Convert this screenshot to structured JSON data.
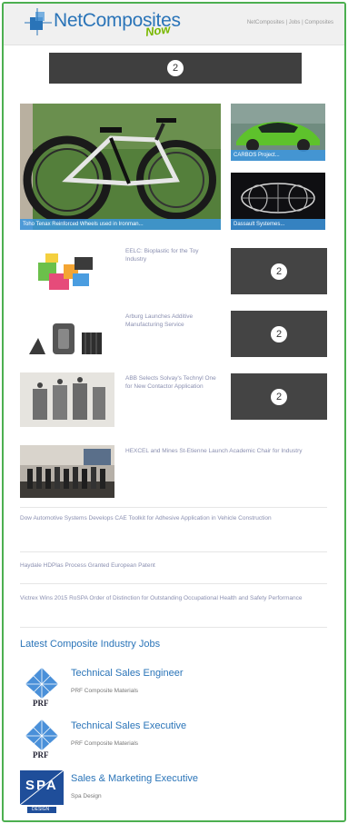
{
  "header": {
    "logo_text": "NetComposites",
    "logo_now": "Now",
    "right_text": "NetComposites | Jobs | Composites"
  },
  "ads": {
    "badge": "2"
  },
  "features": [
    {
      "caption": "Toho Tenax Reinforced Wheels used in Ironman..."
    },
    {
      "caption": "CARBOS Project..."
    },
    {
      "caption": "Dassault Systemes..."
    }
  ],
  "news": [
    {
      "title": "EELC: Bioplastic for the Toy Industry"
    },
    {
      "title": "Arburg Launches Additive Manufacturing Service"
    },
    {
      "title": "ABB Selects Solvay's Technyl One for New Contactor Application"
    },
    {
      "title": "HEXCEL and Mines St-Etienne Launch Academic Chair for Industry"
    }
  ],
  "links": [
    {
      "text": "Dow Automotive Systems Develops CAE Toolkit for Adhesive Application in Vehicle Construction"
    },
    {
      "text": "Haydale HDPlas Process Granted European Patent"
    },
    {
      "text": "Victrex Wins 2015 RoSPA Order of Distinction for Outstanding Occupational Health and Safety Performance"
    }
  ],
  "jobs": {
    "heading": "Latest Composite Industry Jobs",
    "items": [
      {
        "title": "Technical Sales Engineer",
        "company": "PRF Composite Materials",
        "logo_text": "PRF"
      },
      {
        "title": "Technical Sales Executive",
        "company": "PRF Composite Materials",
        "logo_text": "PRF"
      },
      {
        "title": "Sales & Marketing Executive",
        "company": "Spa Design",
        "logo_text": "SPA",
        "logo_sub": "DESIGN"
      }
    ]
  },
  "colors": {
    "brand_blue": "#2a74b8",
    "now_green": "#7ab800",
    "frame_green": "#4caf50",
    "caption_blue": "#3c96e1",
    "ad_gray": "#444444"
  }
}
